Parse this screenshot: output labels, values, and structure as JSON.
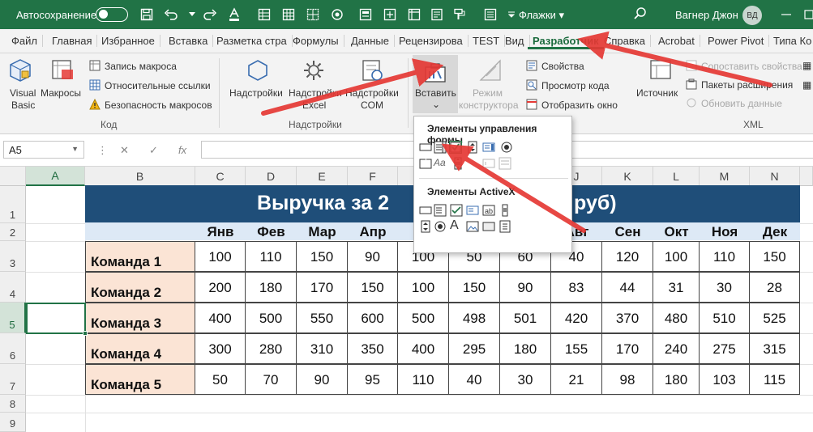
{
  "titlebar": {
    "autosave_label": "Автосохранение",
    "document_name": "Флажки",
    "user_name": "Вагнер Джон",
    "user_initials": "ВД"
  },
  "tabs": [
    {
      "label": "Файл"
    },
    {
      "label": "Главная"
    },
    {
      "label": "Избранное"
    },
    {
      "label": "Вставка"
    },
    {
      "label": "Разметка стра"
    },
    {
      "label": "Формулы"
    },
    {
      "label": "Данные"
    },
    {
      "label": "Рецензирова"
    },
    {
      "label": "TEST"
    },
    {
      "label": "Вид"
    },
    {
      "label": "Разработчик",
      "active": true
    },
    {
      "label": "Справка"
    },
    {
      "label": "Acrobat"
    },
    {
      "label": "Power Pivot"
    },
    {
      "label": "Типа Ко"
    }
  ],
  "ribbon": {
    "code": {
      "visual_basic": "Visual\nBasic",
      "visual_basic_l1": "Visual",
      "visual_basic_l2": "Basic",
      "macros": "Макросы",
      "record_macro": "Запись макроса",
      "relative_refs": "Относительные ссылки",
      "macro_security": "Безопасность макросов",
      "group_label": "Код"
    },
    "addins": {
      "addins": "Надстройки",
      "excel_addins_l1": "Надстройки",
      "excel_addins_l2": "Excel",
      "com_addins_l1": "Надстройки",
      "com_addins_l2": "COM",
      "group_label": "Надстройки"
    },
    "controls": {
      "insert": "Вставить",
      "design_mode_l1": "Режим",
      "design_mode_l2": "конструктора",
      "properties": "Свойства",
      "view_code": "Просмотр кода",
      "run_dialog": "Отобразить окно"
    },
    "xml": {
      "source": "Источник",
      "map_properties": "Сопоставить свойства",
      "expansion_packs": "Пакеты расширения",
      "refresh_data": "Обновить данные",
      "group_label": "XML"
    }
  },
  "formula_bar": {
    "name_box": "A5",
    "fx": "fx",
    "formula": ""
  },
  "dropdown": {
    "form_controls_title": "Элементы управления формы",
    "activex_title": "Элементы ActiveX"
  },
  "sheet": {
    "columns": [
      "A",
      "B",
      "C",
      "D",
      "E",
      "F",
      "G",
      "H",
      "I",
      "J",
      "K",
      "L",
      "M",
      "N"
    ],
    "rows": [
      "1",
      "2",
      "3",
      "4",
      "5",
      "6",
      "7",
      "8",
      "9"
    ],
    "title_left": "Выручка за 2",
    "title_right": "руб)",
    "months": [
      "Янв",
      "Фев",
      "Мар",
      "Апр",
      "М",
      "",
      "",
      "Авг",
      "Сен",
      "Окт",
      "Ноя",
      "Дек"
    ],
    "teams": [
      {
        "name": "Команда 1",
        "values": [
          "100",
          "110",
          "150",
          "90",
          "100",
          "50",
          "60",
          "40",
          "120",
          "100",
          "110",
          "150"
        ]
      },
      {
        "name": "Команда 2",
        "values": [
          "200",
          "180",
          "170",
          "150",
          "100",
          "150",
          "90",
          "83",
          "44",
          "31",
          "30",
          "28"
        ]
      },
      {
        "name": "Команда 3",
        "values": [
          "400",
          "500",
          "550",
          "600",
          "500",
          "498",
          "501",
          "420",
          "370",
          "480",
          "510",
          "525"
        ]
      },
      {
        "name": "Команда 4",
        "values": [
          "300",
          "280",
          "310",
          "350",
          "400",
          "295",
          "180",
          "155",
          "170",
          "240",
          "275",
          "315"
        ]
      },
      {
        "name": "Команда 5",
        "values": [
          "50",
          "70",
          "90",
          "95",
          "110",
          "40",
          "30",
          "21",
          "98",
          "180",
          "103",
          "115"
        ]
      }
    ]
  },
  "colors": {
    "excel_green": "#217346",
    "banner_blue": "#1f4e79",
    "month_row_blue": "#dde9f6",
    "team_cell_peach": "#fbe4d5",
    "arrow_red": "#e53935"
  }
}
